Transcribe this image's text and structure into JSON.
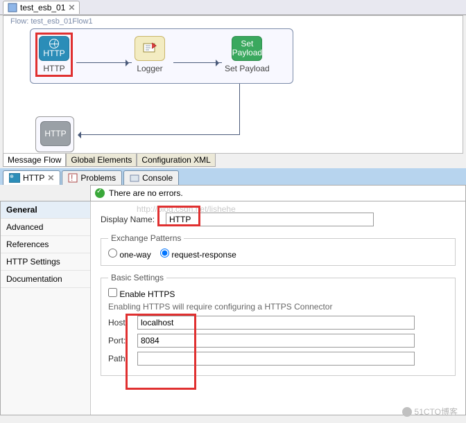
{
  "editor_tab": {
    "title": "test_esb_01"
  },
  "canvas": {
    "flow_name_label": "Flow: test_esb_01Flow1",
    "nodes": {
      "http": {
        "badge": "HTTP",
        "label": "HTTP"
      },
      "logger": {
        "label": "Logger"
      },
      "set_payload": {
        "badge1": "Set",
        "badge2": "Payload",
        "label": "Set Payload"
      },
      "http_grey": {
        "badge": "HTTP"
      }
    },
    "bottom_tabs": [
      "Message Flow",
      "Global Elements",
      "Configuration XML"
    ]
  },
  "lower_tabs": {
    "http": "HTTP",
    "problems": "Problems",
    "console": "Console"
  },
  "status_msg": "There are no errors.",
  "side_nav": [
    "General",
    "Advanced",
    "References",
    "HTTP Settings",
    "Documentation"
  ],
  "form": {
    "display_name_label": "Display Name:",
    "display_name_value": "HTTP",
    "exchange_legend": "Exchange Patterns",
    "one_way": "one-way",
    "req_resp": "request-response",
    "basic_legend": "Basic Settings",
    "enable_https": "Enable HTTPS",
    "https_hint": "Enabling HTTPS will require configuring a HTTPS Connector",
    "host_label": "Host:",
    "host_value": "localhost",
    "port_label": "Port:",
    "port_value": "8084",
    "path_label": "Path:",
    "path_value": ""
  },
  "faint_url": "http://blog.csdn.net/lishehe",
  "watermark": "51CTO博客"
}
